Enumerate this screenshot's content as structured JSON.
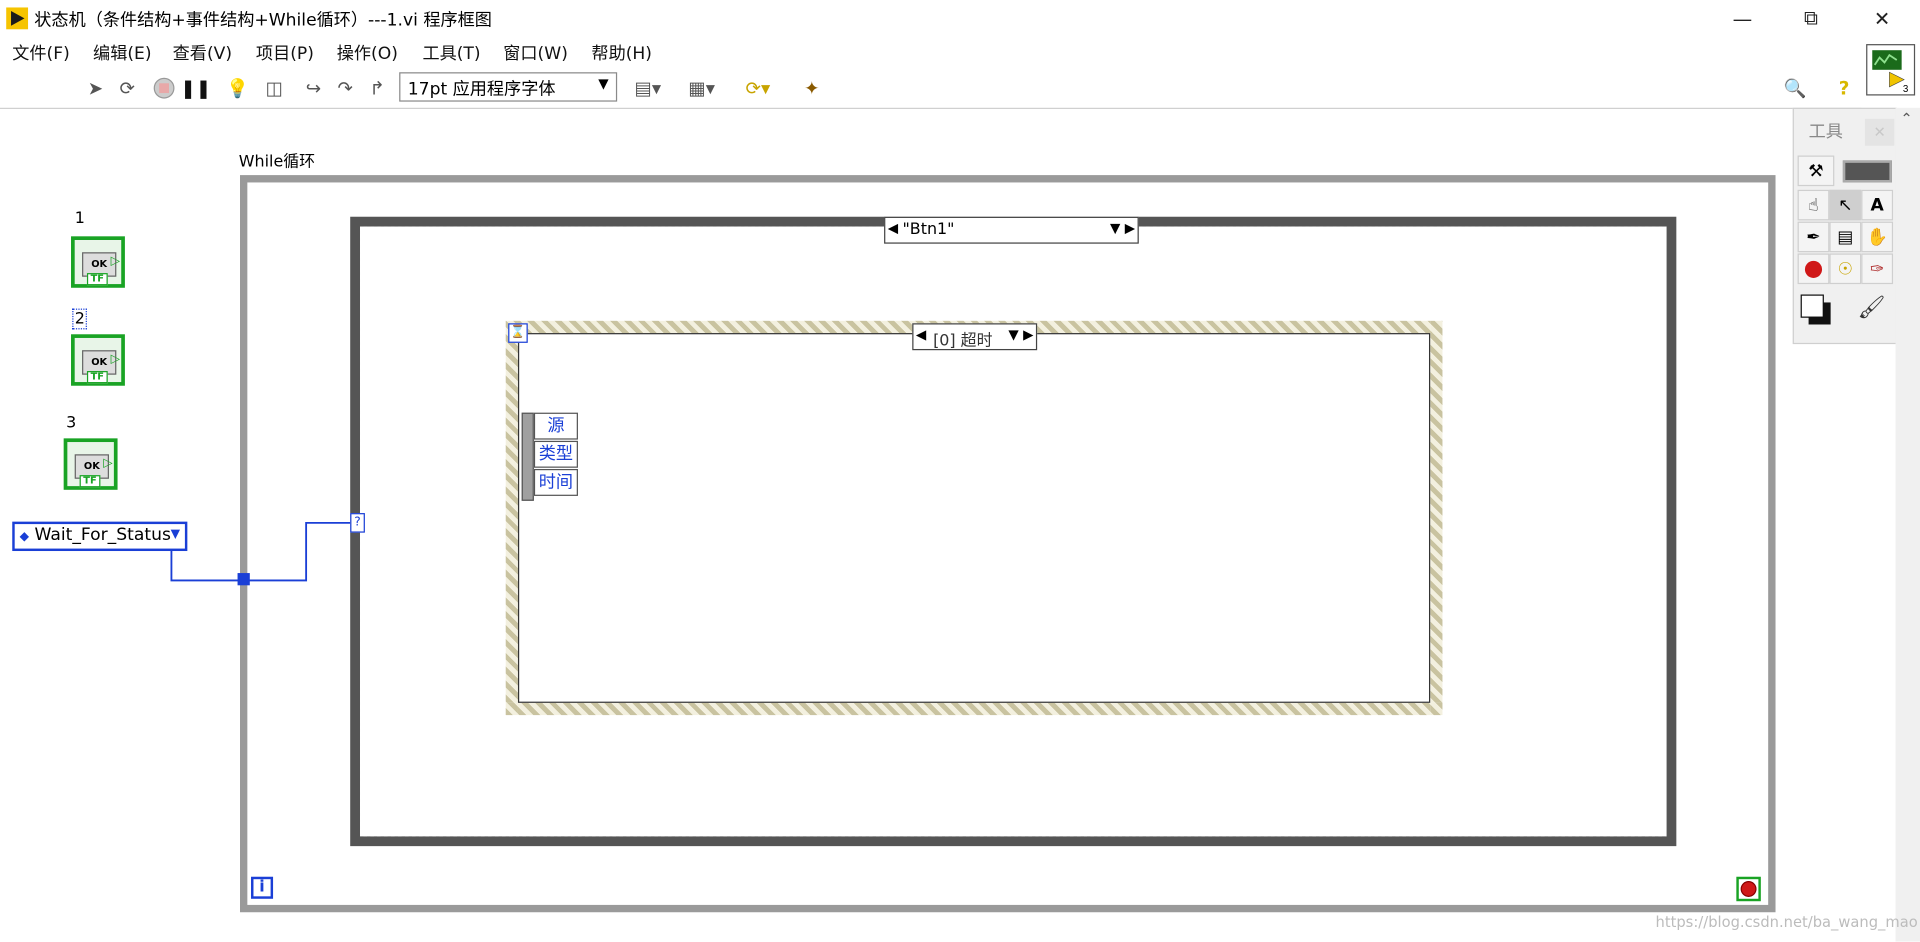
{
  "window": {
    "title": "状态机（条件结构+事件结构+While循环）---1.vi 程序框图",
    "controls": [
      "minimize-icon",
      "restore-icon",
      "close-icon"
    ]
  },
  "menu": [
    "文件(F)",
    "编辑(E)",
    "查看(V)",
    "项目(P)",
    "操作(O)",
    "工具(T)",
    "窗口(W)",
    "帮助(H)"
  ],
  "toolbar": {
    "font_select": "17pt 应用程序字体"
  },
  "diagram": {
    "while_loop_label": "While循环",
    "boolean_labels": [
      "1",
      "2",
      "3"
    ],
    "boolean_ok": "OK",
    "boolean_tf": "TF",
    "enum_value": "Wait_For_Status",
    "case_selector": "\"Btn1\"",
    "case_tunnel": "?",
    "event_selector": "[0] 超时",
    "event_terminals": [
      "源",
      "类型",
      "时间"
    ],
    "iteration_terminal": "i"
  },
  "tools_palette": {
    "title": "工具"
  },
  "watermark": "https://blog.csdn.net/ba_wang_mao"
}
